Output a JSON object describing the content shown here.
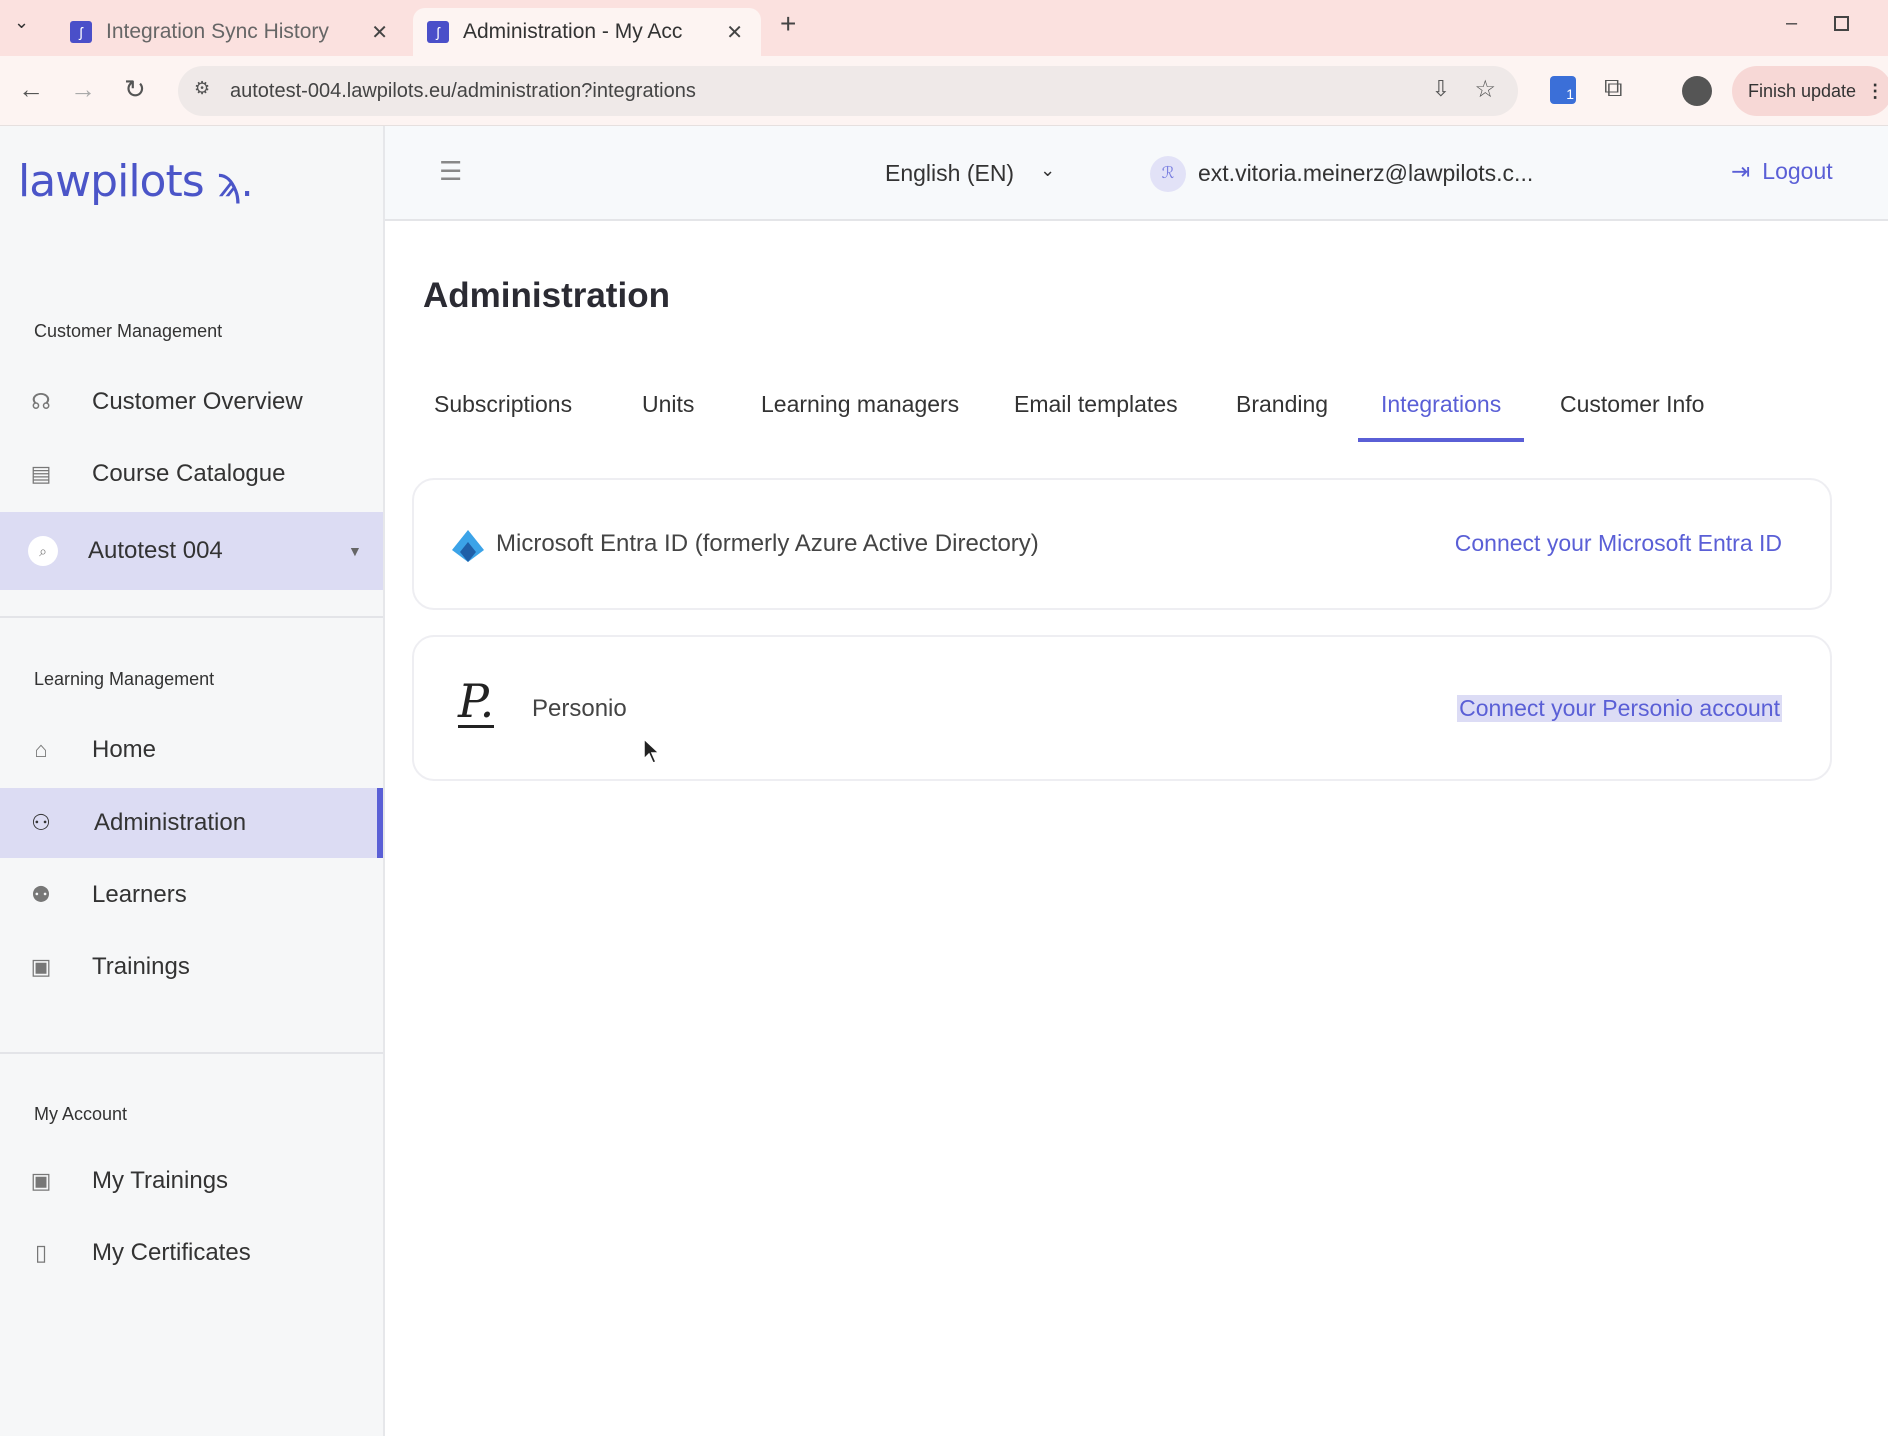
{
  "browser": {
    "tabs": [
      {
        "title": "Integration Sync History",
        "active": false
      },
      {
        "title": "Administration - My Acc",
        "active": true
      }
    ],
    "url": "autotest-004.lawpilots.eu/administration?integrations",
    "finish_update": "Finish update",
    "extension_badge": "1"
  },
  "sidebar": {
    "logo": "lawpilots",
    "sections": [
      {
        "title": "Customer Management",
        "items": [
          {
            "label": "Customer Overview",
            "icon": "headset-icon"
          },
          {
            "label": "Course Catalogue",
            "icon": "book-icon"
          },
          {
            "label": "Autotest 004",
            "icon": "search-icon",
            "selected": true
          }
        ]
      },
      {
        "title": "Learning Management",
        "items": [
          {
            "label": "Home",
            "icon": "home-icon"
          },
          {
            "label": "Administration",
            "icon": "admin-user-icon",
            "active": true
          },
          {
            "label": "Learners",
            "icon": "users-icon"
          },
          {
            "label": "Trainings",
            "icon": "training-icon"
          }
        ]
      },
      {
        "title": "My Account",
        "items": [
          {
            "label": "My Trainings",
            "icon": "training-icon"
          },
          {
            "label": "My Certificates",
            "icon": "certificate-icon"
          }
        ]
      }
    ]
  },
  "header": {
    "language": "English (EN)",
    "user_email": "ext.vitoria.meinerz@lawpilots.c...",
    "logout": "Logout"
  },
  "main": {
    "title": "Administration",
    "tabs": [
      "Subscriptions",
      "Units",
      "Learning managers",
      "Email templates",
      "Branding",
      "Integrations",
      "Customer Info"
    ],
    "active_tab": "Integrations",
    "integrations": [
      {
        "name": "Microsoft Entra ID (formerly Azure Active Directory)",
        "action": "Connect your Microsoft Entra ID"
      },
      {
        "name": "Personio",
        "action": "Connect your Personio account"
      }
    ]
  },
  "colors": {
    "accent": "#5a5fd6",
    "tabbar": "#fbe1df",
    "sidebar_selected": "#dcdcf3"
  }
}
